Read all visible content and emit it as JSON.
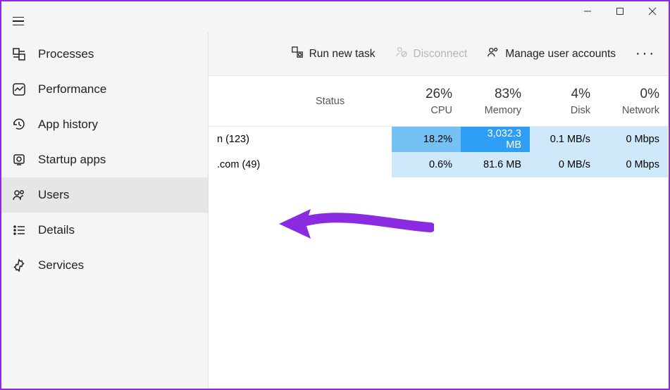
{
  "sidebar": {
    "items": [
      {
        "label": "Processes"
      },
      {
        "label": "Performance"
      },
      {
        "label": "App history"
      },
      {
        "label": "Startup apps"
      },
      {
        "label": "Users"
      },
      {
        "label": "Details"
      },
      {
        "label": "Services"
      }
    ]
  },
  "toolbar": {
    "run_new_task": "Run new task",
    "disconnect": "Disconnect",
    "manage_users": "Manage user accounts"
  },
  "columns": {
    "status": "Status",
    "cpu": {
      "pct": "26%",
      "label": "CPU"
    },
    "memory": {
      "pct": "83%",
      "label": "Memory"
    },
    "disk": {
      "pct": "4%",
      "label": "Disk"
    },
    "network": {
      "pct": "0%",
      "label": "Network"
    }
  },
  "rows": [
    {
      "name": "n (123)",
      "status": "",
      "cpu": "18.2%",
      "memory": "3,032.3 MB",
      "disk": "0.1 MB/s",
      "network": "0 Mbps",
      "heat": [
        "heat-med",
        "heat-high",
        "heat-low",
        "heat-low"
      ]
    },
    {
      "name": ".com (49)",
      "status": "",
      "cpu": "0.6%",
      "memory": "81.6 MB",
      "disk": "0 MB/s",
      "network": "0 Mbps",
      "heat": [
        "heat-low",
        "heat-low",
        "heat-low",
        "heat-low"
      ]
    }
  ]
}
